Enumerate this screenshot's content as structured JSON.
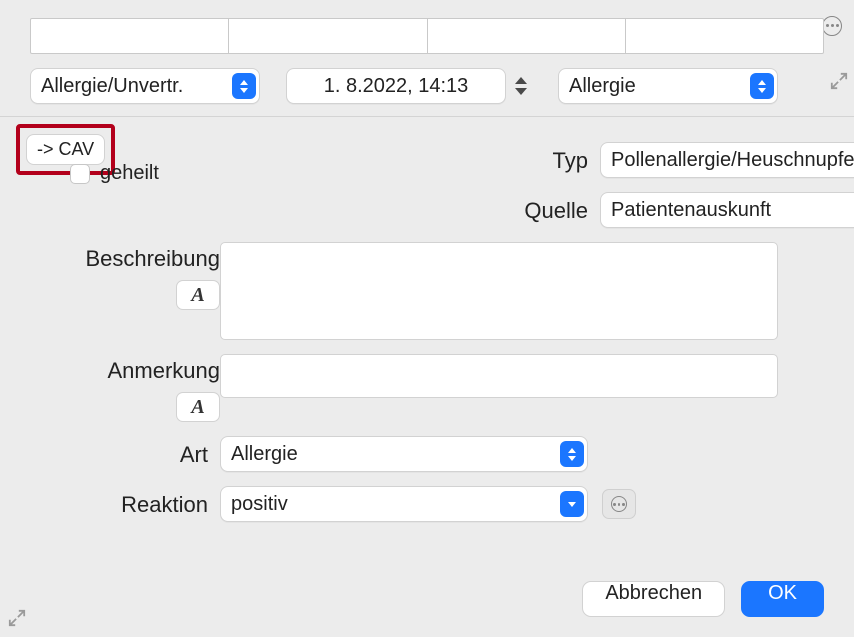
{
  "header": {
    "category_select": "Allergie/Unvertr.",
    "datetime": "1.  8.2022, 14:13",
    "type_select": "Allergie"
  },
  "cav_button": "-> CAV",
  "form": {
    "typ": {
      "label": "Typ",
      "value": "Pollenallergie/Heuschnupfen"
    },
    "quelle": {
      "label": "Quelle",
      "value": "Patientenauskunft"
    },
    "geheilt": {
      "label": "geheilt"
    },
    "beschreibung": {
      "label": "Beschreibung",
      "format_button": "A",
      "value": ""
    },
    "anmerkung": {
      "label": "Anmerkung",
      "format_button": "A",
      "value": ""
    },
    "art": {
      "label": "Art",
      "value": "Allergie"
    },
    "reaktion": {
      "label": "Reaktion",
      "value": "positiv"
    }
  },
  "footer": {
    "cancel": "Abbrechen",
    "ok": "OK"
  }
}
